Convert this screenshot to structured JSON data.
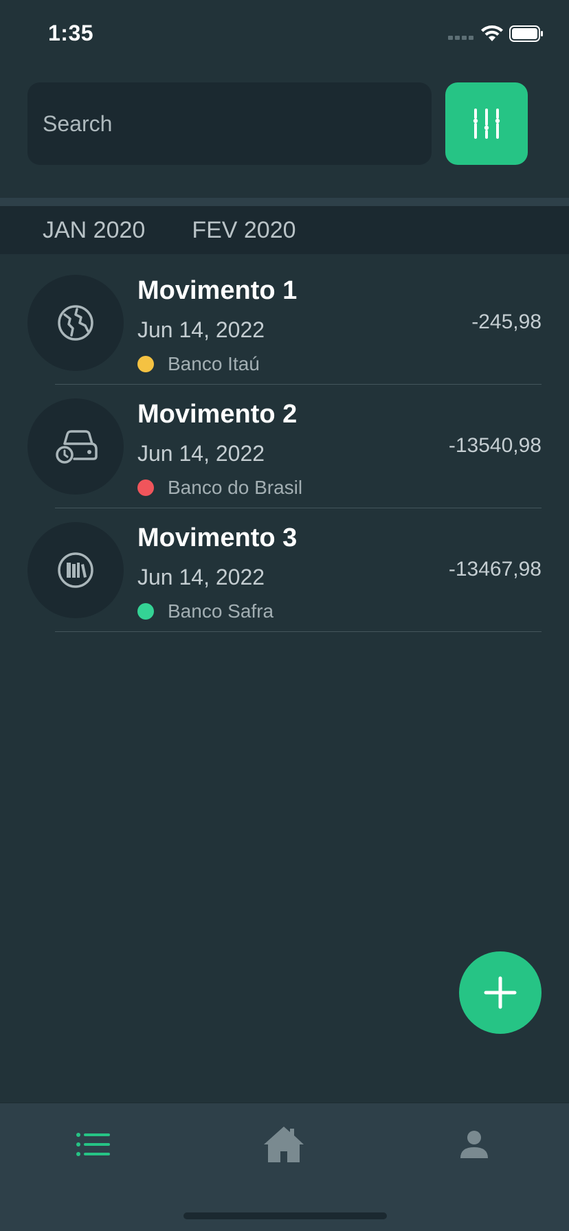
{
  "status_bar": {
    "time": "1:35"
  },
  "search": {
    "placeholder": "Search"
  },
  "months": [
    "JAN 2020",
    "FEV 2020"
  ],
  "transactions": [
    {
      "title": "Movimento 1",
      "date": "Jun 14, 2022",
      "bank": "Banco Itaú",
      "bank_color": "#f5c242",
      "amount": "-245,98",
      "icon": "globe-icon"
    },
    {
      "title": "Movimento 2",
      "date": "Jun 14, 2022",
      "bank": "Banco do Brasil",
      "bank_color": "#f0555b",
      "amount": "-13540,98",
      "icon": "car-clock-icon"
    },
    {
      "title": "Movimento 3",
      "date": "Jun 14, 2022",
      "bank": "Banco Safra",
      "bank_color": "#34d395",
      "amount": "-13467,98",
      "icon": "books-icon"
    }
  ],
  "tabs": [
    {
      "name": "list-icon",
      "active": true
    },
    {
      "name": "home-icon",
      "active": false
    },
    {
      "name": "profile-icon",
      "active": false
    }
  ],
  "colors": {
    "accent": "#26c485",
    "background": "#223339",
    "surface": "#1b2930",
    "tab_bar": "#2e4049"
  }
}
